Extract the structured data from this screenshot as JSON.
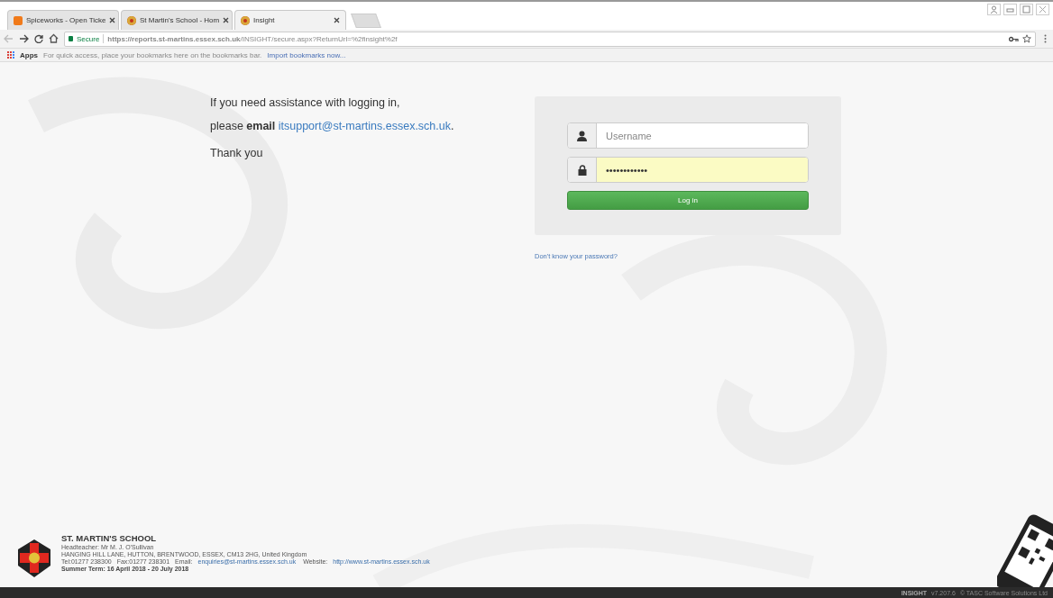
{
  "browser": {
    "tabs": [
      {
        "title": "Spiceworks - Open Ticke",
        "selected": false
      },
      {
        "title": "St Martin's School - Hom",
        "selected": false
      },
      {
        "title": "Insight",
        "selected": true
      }
    ],
    "secure_label": "Secure",
    "url": "**https://reports.st-martins.essex.sch.uk**/INSIGHT/secure.aspx?ReturnUrl=%2finsight%2f",
    "bookmarks": {
      "apps": "Apps",
      "hint": "For quick access, place your bookmarks here on the bookmarks bar.",
      "import_link": "Import bookmarks now..."
    }
  },
  "assistance": {
    "line_1": "If you need assistance with logging in,",
    "line_2_lead": "please **email**",
    "email_link": "itsupport@st-martins.essex.sch.uk",
    "line_2_end": ".",
    "thanks": "Thank you"
  },
  "login": {
    "username": {
      "placeholder": "Username"
    },
    "password": {
      "value": "••••••••••••"
    },
    "button": "Log in",
    "forgot_link": "Don't know your password?"
  },
  "footer": {
    "school": "ST. MARTIN'S SCHOOL",
    "headteacher": "Headteacher: Mr M. J. O'Sullivan",
    "address": "HANGING HILL LANE, HUTTON, BRENTWOOD, ESSEX, CM13 2HG, United Kingdom",
    "tel": "Tel:01277 238300",
    "fax": "Fax:01277 238301",
    "email_label": "Email:",
    "email": "enquiries@st-martins.essex.sch.uk",
    "website_label": "Website:",
    "website": "http://www.st-martins.essex.sch.uk",
    "term": "Summer Term: 16 April 2018 - 20 July 2018"
  },
  "version_bar": {
    "product": "INSIGHT",
    "version": "v7.207.6",
    "copyright": "© TASC Software Solutions Ltd"
  }
}
